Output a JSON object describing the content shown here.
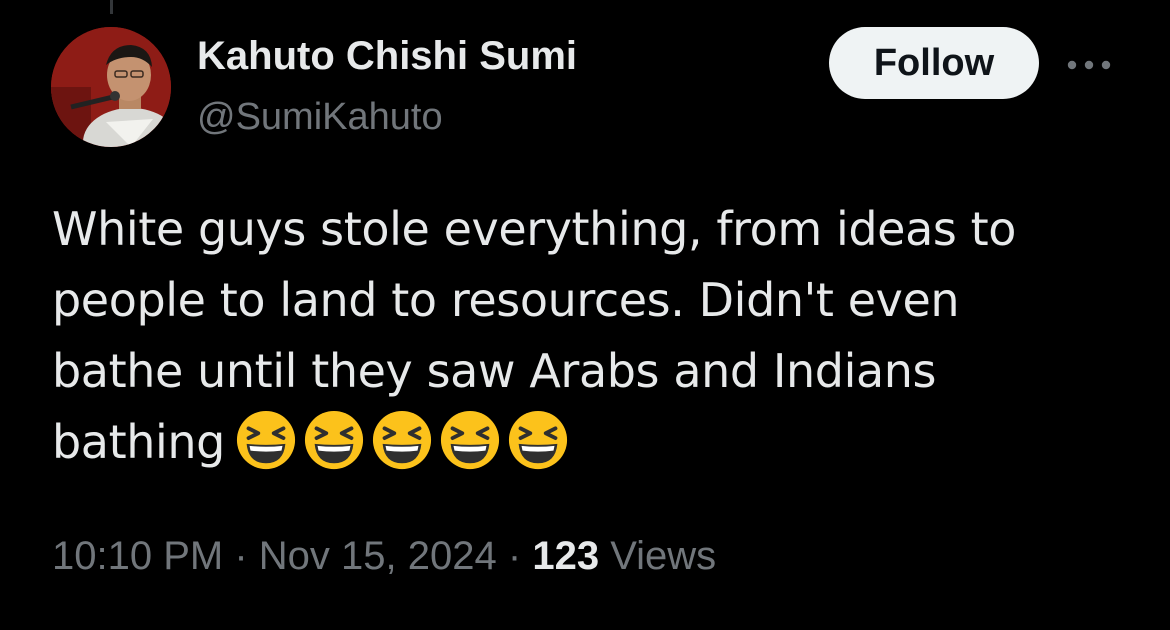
{
  "author": {
    "display_name": "Kahuto Chishi Sumi",
    "handle": "@SumiKahuto"
  },
  "actions": {
    "follow_label": "Follow",
    "more_icon": "more-horizontal-icon"
  },
  "tweet": {
    "lines": [
      "White guys stole everything, from ideas to",
      "people to land to resources. Didn't even",
      "bathe until they saw Arabs and Indians",
      "bathing"
    ],
    "emoji": [
      "laughing-emoji",
      "laughing-emoji",
      "laughing-emoji",
      "laughing-emoji",
      "laughing-emoji"
    ]
  },
  "meta": {
    "time": "10:10 PM",
    "separator": "·",
    "date": "Nov 15, 2024",
    "views_count": "123",
    "views_label": "Views"
  },
  "colors": {
    "background": "#000000",
    "text_primary": "#e7e9ea",
    "text_secondary": "#71767b",
    "follow_bg": "#eff3f4",
    "emoji_yellow": "#fcc21b"
  }
}
